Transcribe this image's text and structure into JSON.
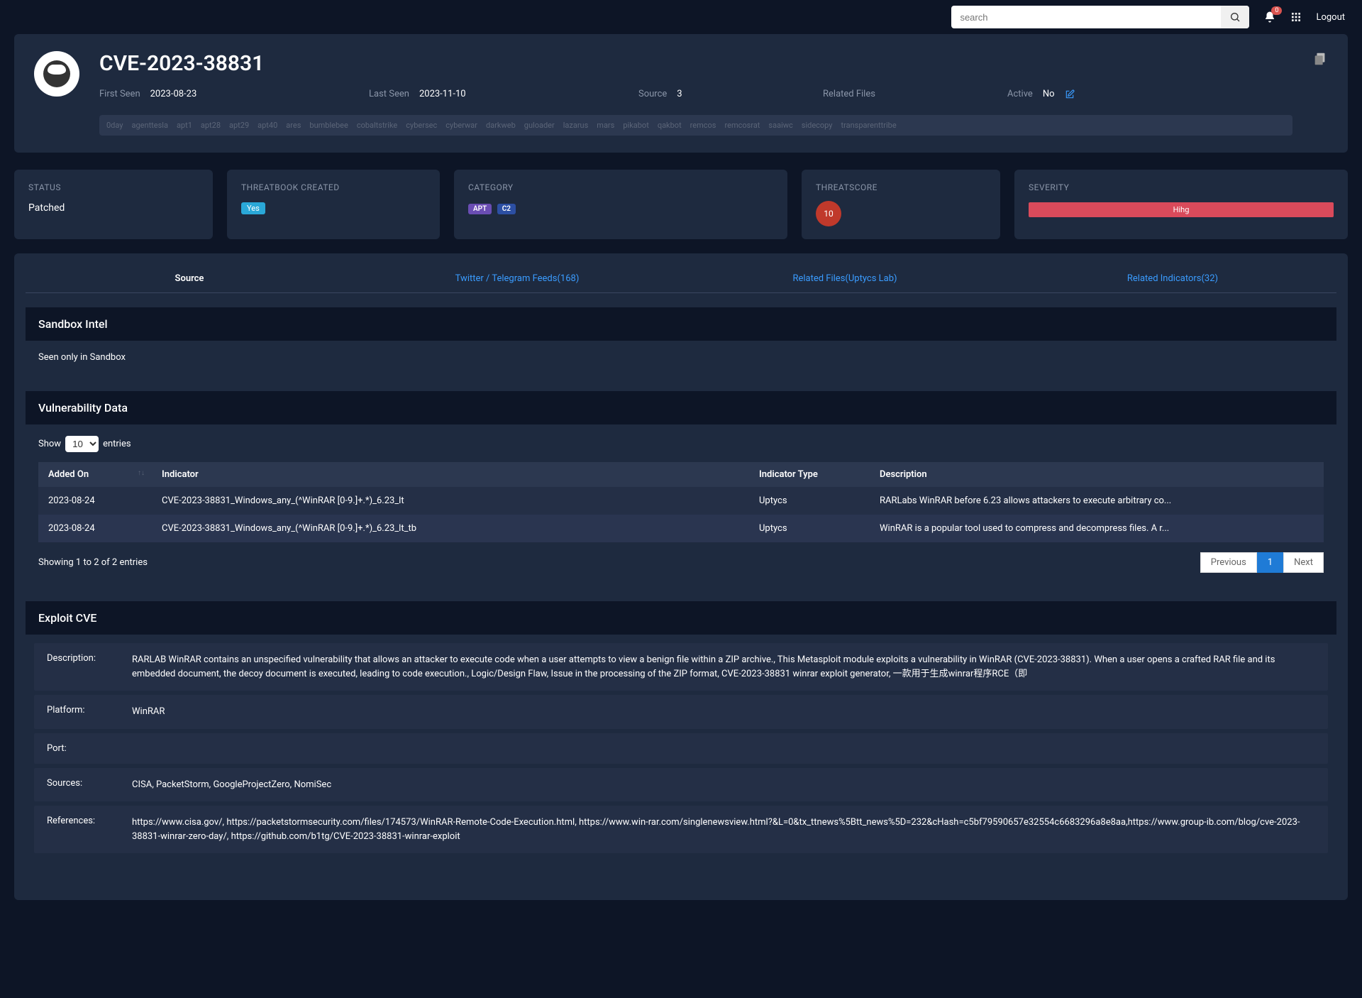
{
  "topbar": {
    "search_placeholder": "search",
    "notification_count": "0",
    "logout": "Logout"
  },
  "header": {
    "title": "CVE-2023-38831",
    "first_seen_label": "First Seen",
    "first_seen": "2023-08-23",
    "last_seen_label": "Last Seen",
    "last_seen": "2023-11-10",
    "source_label": "Source",
    "source": "3",
    "related_files_label": "Related Files",
    "related_files": "",
    "active_label": "Active",
    "active": "No",
    "tags": [
      "0day",
      "agenttesla",
      "apt1",
      "apt28",
      "apt29",
      "apt40",
      "ares",
      "bumblebee",
      "cobaltstrike",
      "cybersec",
      "cyberwar",
      "darkweb",
      "guloader",
      "lazarus",
      "mars",
      "pikabot",
      "qakbot",
      "remcos",
      "remcosrat",
      "saaiwc",
      "sidecopy",
      "transparenttribe"
    ]
  },
  "cards": {
    "status_label": "STATUS",
    "status": "Patched",
    "created_label": "THREATBOOK CREATED",
    "created": "Yes",
    "category_label": "CATEGORY",
    "category": [
      "APT",
      "C2"
    ],
    "score_label": "THREATSCORE",
    "score": "10",
    "severity_label": "SEVERITY",
    "severity": "Hihg"
  },
  "tabs": [
    "Source",
    "Twitter / Telegram Feeds(168)",
    "Related Files(Uptycs Lab)",
    "Related Indicators(32)"
  ],
  "sandbox": {
    "title": "Sandbox Intel",
    "body": "Seen only in Sandbox"
  },
  "vuln": {
    "title": "Vulnerability Data",
    "show_prefix": "Show",
    "show_value": "10",
    "show_suffix": "entries",
    "cols": [
      "Added On",
      "Indicator",
      "Indicator Type",
      "Description"
    ],
    "rows": [
      {
        "added": "2023-08-24",
        "indicator": "CVE-2023-38831_Windows_any_(^WinRAR [0-9.]+.*)_6.23_lt",
        "type": "Uptycs",
        "desc": "RARLabs WinRAR before 6.23 allows attackers to execute arbitrary co..."
      },
      {
        "added": "2023-08-24",
        "indicator": "CVE-2023-38831_Windows_any_(^WinRAR [0-9.]+.*)_6.23_lt_tb",
        "type": "Uptycs",
        "desc": "WinRAR is a popular tool used to compress and decompress files. A r..."
      }
    ],
    "showing": "Showing 1 to 2 of 2 entries",
    "prev": "Previous",
    "page": "1",
    "next": "Next"
  },
  "exploit": {
    "title": "Exploit CVE",
    "rows": [
      {
        "label": "Description:",
        "value": "RARLAB WinRAR contains an unspecified vulnerability that allows an attacker to execute code when a user attempts to view a benign file within a ZIP archive., This Metasploit module exploits a vulnerability in WinRAR (CVE-2023-38831). When a user opens a crafted RAR file and its embedded document, the decoy document is executed, leading to code execution., Logic/Design Flaw, Issue in the processing of the ZIP format, CVE-2023-38831 winrar exploit generator, 一款用于生成winrar程序RCE（即"
      },
      {
        "label": "Platform:",
        "value": "WinRAR"
      },
      {
        "label": "Port:",
        "value": ""
      },
      {
        "label": "Sources:",
        "value": "CISA, PacketStorm, GoogleProjectZero, NomiSec"
      },
      {
        "label": "References:",
        "value": "https://www.cisa.gov/, https://packetstormsecurity.com/files/174573/WinRAR-Remote-Code-Execution.html, https://www.win-rar.com/singlenewsview.html?&L=0&tx_ttnews%5Btt_news%5D=232&cHash=c5bf79590657e32554c6683296a8e8aa,https://www.group-ib.com/blog/cve-2023-38831-winrar-zero-day/, https://github.com/b1tg/CVE-2023-38831-winrar-exploit"
      }
    ]
  }
}
